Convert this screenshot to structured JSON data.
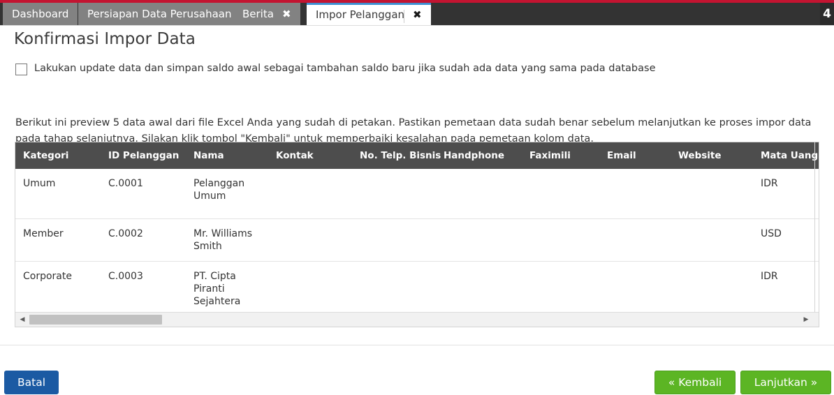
{
  "tabstrip": {
    "accent_color": "#c31431",
    "background_color": "#333333",
    "counter": "4",
    "tabs": [
      {
        "label": "Dashboard",
        "closable": false,
        "active": false
      },
      {
        "label": "Persiapan Data Perusahaan",
        "closable": false,
        "active": false
      },
      {
        "label": "Berita",
        "close_glyph": "✖",
        "closable": true,
        "active": false
      },
      {
        "label": "Impor Pelanggan",
        "close_glyph": "✖",
        "closable": true,
        "active": true
      }
    ]
  },
  "page": {
    "title": "Konfirmasi Impor Data",
    "update_option": {
      "checked": false,
      "label": "Lakukan update data dan simpan saldo awal sebagai tambahan saldo baru jika sudah ada data yang sama pada database"
    },
    "intro_text": "Berikut ini preview 5 data awal dari file Excel Anda yang sudah di petakan. Pastikan pemetaan data sudah benar sebelum melanjutkan ke proses impor data pada tahap selanjutnya. Silakan klik tombol \"Kembali\" untuk memperbaiki kesalahan pada pemetaan kolom data."
  },
  "preview_table": {
    "columns": [
      "Kategori",
      "ID Pelanggan",
      "Nama",
      "Kontak",
      "No. Telp. Bisnis",
      "Handphone",
      "Faximili",
      "Email",
      "Website",
      "Mata Uang"
    ],
    "rows": [
      {
        "kategori": "Umum",
        "id_pelanggan": "C.0001",
        "nama": "Pelanggan Umum",
        "kontak": "",
        "telp_bisnis": "",
        "handphone": "",
        "faximili": "",
        "email": "",
        "website": "",
        "mata_uang": "IDR"
      },
      {
        "kategori": "Member",
        "id_pelanggan": "C.0002",
        "nama": "Mr. Williams Smith",
        "kontak": "",
        "telp_bisnis": "",
        "handphone": "",
        "faximili": "",
        "email": "",
        "website": "",
        "mata_uang": "USD"
      },
      {
        "kategori": "Corporate",
        "id_pelanggan": "C.0003",
        "nama": "PT. Cipta Piranti Sejahtera",
        "kontak": "",
        "telp_bisnis": "",
        "handphone": "",
        "faximili": "",
        "email": "",
        "website": "",
        "mata_uang": "IDR"
      }
    ],
    "scrollbar": {
      "left_arrow_glyph": "◀",
      "right_arrow_glyph": "▶",
      "orientation": "horizontal"
    },
    "header_background": "#4d4d4d"
  },
  "footer": {
    "cancel_label": "Batal",
    "back_label": "« Kembali",
    "next_label": "Lanjutkan »",
    "cancel_color": "#1b5aa3",
    "action_color": "#5cb524"
  }
}
